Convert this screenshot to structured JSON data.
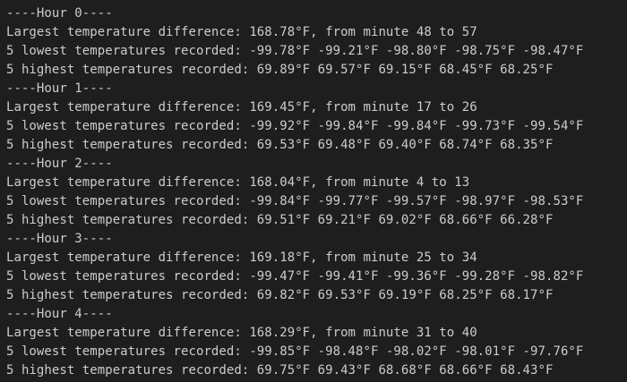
{
  "colors": {
    "background": "#1e1e1e",
    "text": "#cccccc"
  },
  "output": {
    "lines": [
      "----Hour 0----",
      "Largest temperature difference: 168.78°F, from minute 48 to 57",
      "5 lowest temperatures recorded: -99.78°F -99.21°F -98.80°F -98.75°F -98.47°F",
      "5 highest temperatures recorded: 69.89°F 69.57°F 69.15°F 68.45°F 68.25°F",
      "----Hour 1----",
      "Largest temperature difference: 169.45°F, from minute 17 to 26",
      "5 lowest temperatures recorded: -99.92°F -99.84°F -99.84°F -99.73°F -99.54°F",
      "5 highest temperatures recorded: 69.53°F 69.48°F 69.40°F 68.74°F 68.35°F",
      "----Hour 2----",
      "Largest temperature difference: 168.04°F, from minute 4 to 13",
      "5 lowest temperatures recorded: -99.84°F -99.77°F -99.57°F -98.97°F -98.53°F",
      "5 highest temperatures recorded: 69.51°F 69.21°F 69.02°F 68.66°F 66.28°F",
      "----Hour 3----",
      "Largest temperature difference: 169.18°F, from minute 25 to 34",
      "5 lowest temperatures recorded: -99.47°F -99.41°F -99.36°F -99.28°F -98.82°F",
      "5 highest temperatures recorded: 69.82°F 69.53°F 69.19°F 68.25°F 68.17°F",
      "----Hour 4----",
      "Largest temperature difference: 168.29°F, from minute 31 to 40",
      "5 lowest temperatures recorded: -99.85°F -98.48°F -98.02°F -98.01°F -97.76°F",
      "5 highest temperatures recorded: 69.75°F 69.43°F 68.68°F 68.66°F 68.43°F"
    ]
  }
}
